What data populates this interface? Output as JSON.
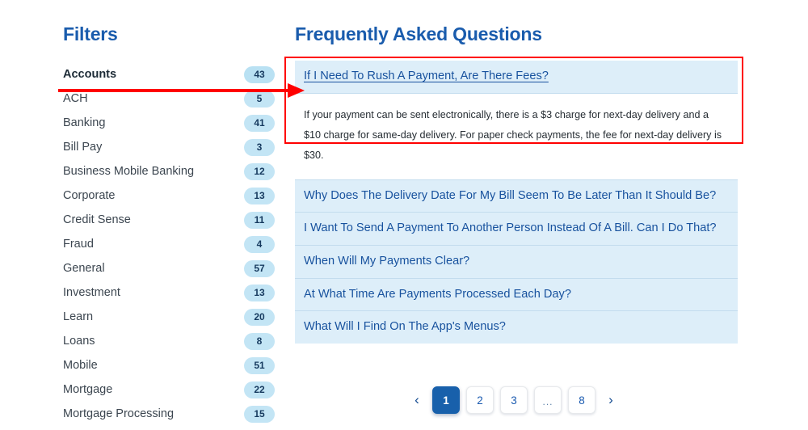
{
  "filters": {
    "title": "Filters",
    "items": [
      {
        "label": "Accounts",
        "count": "43",
        "selected": true
      },
      {
        "label": "ACH",
        "count": "5",
        "selected": false
      },
      {
        "label": "Banking",
        "count": "41",
        "selected": false
      },
      {
        "label": "Bill Pay",
        "count": "3",
        "selected": false
      },
      {
        "label": "Business Mobile Banking",
        "count": "12",
        "selected": false
      },
      {
        "label": "Corporate",
        "count": "13",
        "selected": false
      },
      {
        "label": "Credit Sense",
        "count": "11",
        "selected": false
      },
      {
        "label": "Fraud",
        "count": "4",
        "selected": false
      },
      {
        "label": "General",
        "count": "57",
        "selected": false
      },
      {
        "label": "Investment",
        "count": "13",
        "selected": false
      },
      {
        "label": "Learn",
        "count": "20",
        "selected": false
      },
      {
        "label": "Loans",
        "count": "8",
        "selected": false
      },
      {
        "label": "Mobile",
        "count": "51",
        "selected": false
      },
      {
        "label": "Mortgage",
        "count": "22",
        "selected": false
      },
      {
        "label": "Mortgage Processing",
        "count": "15",
        "selected": false
      }
    ]
  },
  "faq": {
    "title": "Frequently Asked Questions",
    "items": [
      {
        "question": "If I Need To Rush A Payment, Are There Fees?",
        "open": true,
        "answer": "If your payment can be sent electronically, there is a $3 charge for next-day delivery and a $10 charge for same-day delivery. For paper check payments, the fee for next-day delivery is $30."
      },
      {
        "question": "Why Does The Delivery Date For My Bill Seem To Be Later Than It Should Be?",
        "open": false,
        "answer": ""
      },
      {
        "question": "I Want To Send A Payment To Another Person Instead Of A Bill. Can I Do That?",
        "open": false,
        "answer": ""
      },
      {
        "question": "When Will My Payments Clear?",
        "open": false,
        "answer": ""
      },
      {
        "question": "At What Time Are Payments Processed Each Day?",
        "open": false,
        "answer": ""
      },
      {
        "question": "What Will I Find On The App's Menus?",
        "open": false,
        "answer": ""
      }
    ]
  },
  "pagination": {
    "prev_label": "‹",
    "next_label": "›",
    "pages": [
      {
        "label": "1",
        "active": true,
        "ellipsis": false
      },
      {
        "label": "2",
        "active": false,
        "ellipsis": false
      },
      {
        "label": "3",
        "active": false,
        "ellipsis": false
      },
      {
        "label": "...",
        "active": false,
        "ellipsis": true
      },
      {
        "label": "8",
        "active": false,
        "ellipsis": false
      }
    ]
  },
  "annotations": {
    "color": "#ff0000",
    "arrow_target": "first-faq-item",
    "box_target": "first-faq-item"
  },
  "colors": {
    "heading_blue": "#1a5cad",
    "link_blue": "#18529e",
    "badge_bg": "#c3e5f5",
    "faq_bg": "#ddeef9",
    "active_page_bg": "#1860ab",
    "annotation_red": "#ff0000"
  }
}
